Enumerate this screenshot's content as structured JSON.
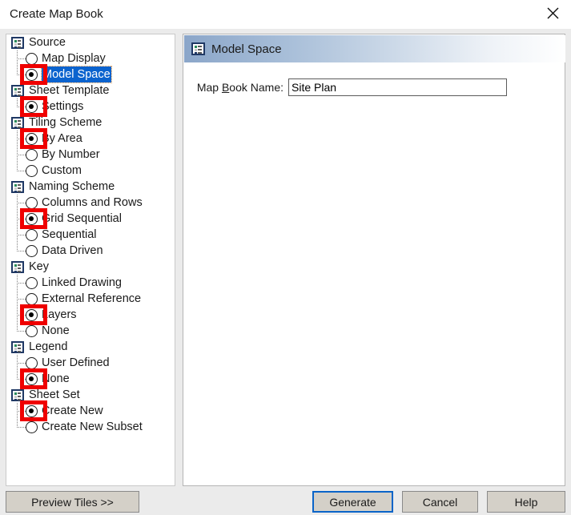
{
  "window": {
    "title": "Create Map Book",
    "close_icon": "close-icon"
  },
  "tree": {
    "groups": [
      {
        "label": "Source",
        "icon": "tree-node-icon",
        "items": [
          {
            "label": "Map Display",
            "checked": false,
            "highlighted": false,
            "annotated": false
          },
          {
            "label": "Model Space",
            "checked": true,
            "highlighted": true,
            "annotated": true
          }
        ]
      },
      {
        "label": "Sheet Template",
        "icon": "tree-node-icon",
        "items": [
          {
            "label": "Settings",
            "checked": true,
            "highlighted": false,
            "annotated": true
          }
        ]
      },
      {
        "label": "Tiling Scheme",
        "icon": "tree-node-icon",
        "items": [
          {
            "label": "By Area",
            "checked": true,
            "highlighted": false,
            "annotated": true
          },
          {
            "label": "By Number",
            "checked": false,
            "highlighted": false,
            "annotated": false
          },
          {
            "label": "Custom",
            "checked": false,
            "highlighted": false,
            "annotated": false
          }
        ]
      },
      {
        "label": "Naming Scheme",
        "icon": "tree-node-icon",
        "items": [
          {
            "label": "Columns and Rows",
            "checked": false,
            "highlighted": false,
            "annotated": false
          },
          {
            "label": "Grid Sequential",
            "checked": true,
            "highlighted": false,
            "annotated": true
          },
          {
            "label": "Sequential",
            "checked": false,
            "highlighted": false,
            "annotated": false
          },
          {
            "label": "Data Driven",
            "checked": false,
            "highlighted": false,
            "annotated": false
          }
        ]
      },
      {
        "label": "Key",
        "icon": "tree-node-icon",
        "items": [
          {
            "label": "Linked Drawing",
            "checked": false,
            "highlighted": false,
            "annotated": false
          },
          {
            "label": "External Reference",
            "checked": false,
            "highlighted": false,
            "annotated": false
          },
          {
            "label": "Layers",
            "checked": true,
            "highlighted": false,
            "annotated": true
          },
          {
            "label": "None",
            "checked": false,
            "highlighted": false,
            "annotated": false
          }
        ]
      },
      {
        "label": "Legend",
        "icon": "tree-node-icon",
        "items": [
          {
            "label": "User Defined",
            "checked": false,
            "highlighted": false,
            "annotated": false
          },
          {
            "label": "None",
            "checked": true,
            "highlighted": false,
            "annotated": true
          }
        ]
      },
      {
        "label": "Sheet Set",
        "icon": "tree-node-icon",
        "items": [
          {
            "label": "Create New",
            "checked": true,
            "highlighted": false,
            "annotated": true
          },
          {
            "label": "Create New Subset",
            "checked": false,
            "highlighted": false,
            "annotated": false
          }
        ]
      }
    ]
  },
  "content": {
    "header_title": "Model Space",
    "header_icon": "tree-node-icon",
    "field_label_prefix": "Map ",
    "field_label_accel": "B",
    "field_label_suffix": "ook Name:",
    "mapbook_name_value": "Site Plan",
    "mapbook_name_placeholder": ""
  },
  "buttons": {
    "preview": "Preview Tiles >>",
    "generate": "Generate",
    "cancel": "Cancel",
    "help": "Help"
  },
  "colors": {
    "selection_blue": "#0b63ce",
    "annotation_red": "#ef0000",
    "focus_blue": "#0a64c8",
    "header_gradient_start": "#8ba6c9",
    "dialog_background": "#ebebeb",
    "button_face": "#d4d0c8"
  }
}
